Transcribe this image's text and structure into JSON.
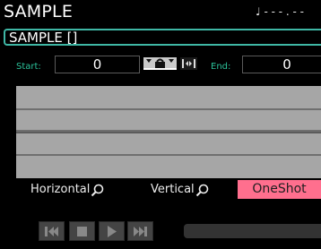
{
  "header": {
    "title": "SAMPLE",
    "tempo_indicator": "♩ - - - . - -"
  },
  "sample": {
    "name": "SAMPLE []"
  },
  "range": {
    "start_label": "Start:",
    "start_value": "0",
    "end_label": "End:",
    "end_value": "0"
  },
  "toolbar_icons": {
    "snap": "snap-icon",
    "mode": "play-mode-icon"
  },
  "modes": {
    "horizontal_label": "Horizontal",
    "vertical_label": "Vertical",
    "oneshot_label": "OneShot",
    "zoom_icon": "zoom-icon"
  },
  "colors": {
    "accent": "#3fb7a5",
    "oneshot_active": "#ff6f8e",
    "label_green": "#2bc29a",
    "waveform_bg": "#a6a6a6"
  },
  "transport": {
    "icons": [
      "skip-back-icon",
      "stop-icon",
      "play-icon",
      "fast-forward-icon"
    ]
  }
}
